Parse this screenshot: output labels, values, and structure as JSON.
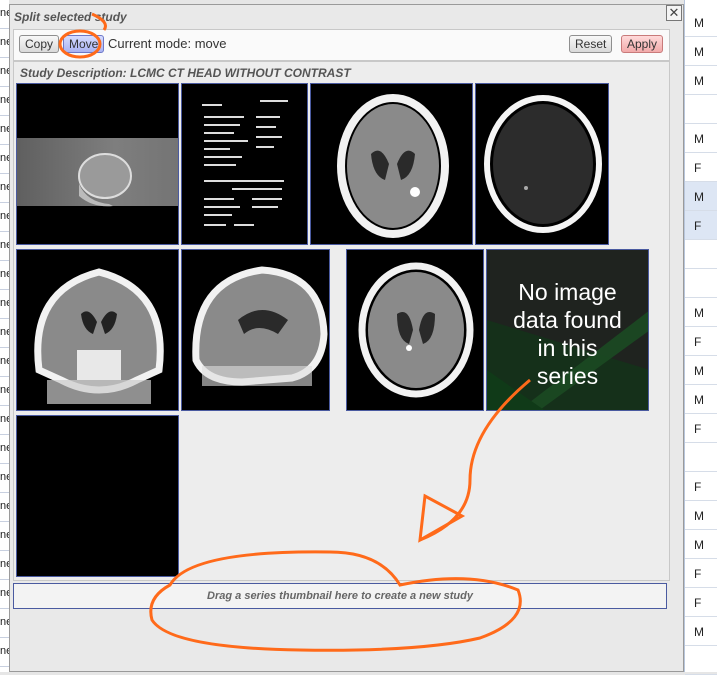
{
  "background": {
    "left_rows": [
      "ne",
      "ne",
      "ne",
      "ne",
      "ne",
      "ne",
      "ne",
      "ne",
      "ne",
      "ne",
      "ne",
      "ne",
      "ne",
      "ne",
      "ne",
      "ne",
      "ne",
      "ne",
      "ne",
      "ne",
      "ne",
      "ne",
      "ne"
    ],
    "right_rows": [
      {
        "value": "M"
      },
      {
        "value": "M"
      },
      {
        "value": "M"
      },
      {
        "value": ""
      },
      {
        "value": "M"
      },
      {
        "value": "F"
      },
      {
        "value": "M"
      },
      {
        "value": "F"
      },
      {
        "value": ""
      },
      {
        "value": ""
      },
      {
        "value": "M"
      },
      {
        "value": "F"
      },
      {
        "value": "M"
      },
      {
        "value": "M"
      },
      {
        "value": "F"
      },
      {
        "value": ""
      },
      {
        "value": "F"
      },
      {
        "value": "M"
      },
      {
        "value": "M"
      },
      {
        "value": "F"
      },
      {
        "value": "F"
      },
      {
        "value": "M"
      },
      {
        "value": ""
      }
    ]
  },
  "dialog": {
    "title": "Split selected study",
    "close_label": "✕",
    "toolbar": {
      "copy_label": "Copy",
      "move_label": "Move",
      "mode_text": "Current mode: move",
      "reset_label": "Reset",
      "apply_label": "Apply"
    },
    "study_description": "Study Description: LCMC CT HEAD WITHOUT CONTRAST",
    "no_image_text_lines": [
      "No image",
      "data found",
      "in this",
      "series"
    ],
    "dropzone_text": "Drag a series thumbnail here to create a new study"
  },
  "colors": {
    "move_button": "#a9b2f2",
    "apply_button": "#f2a9a9",
    "annotation": "#ff6a1a",
    "thumbnail_border": "#4a5aa0"
  }
}
